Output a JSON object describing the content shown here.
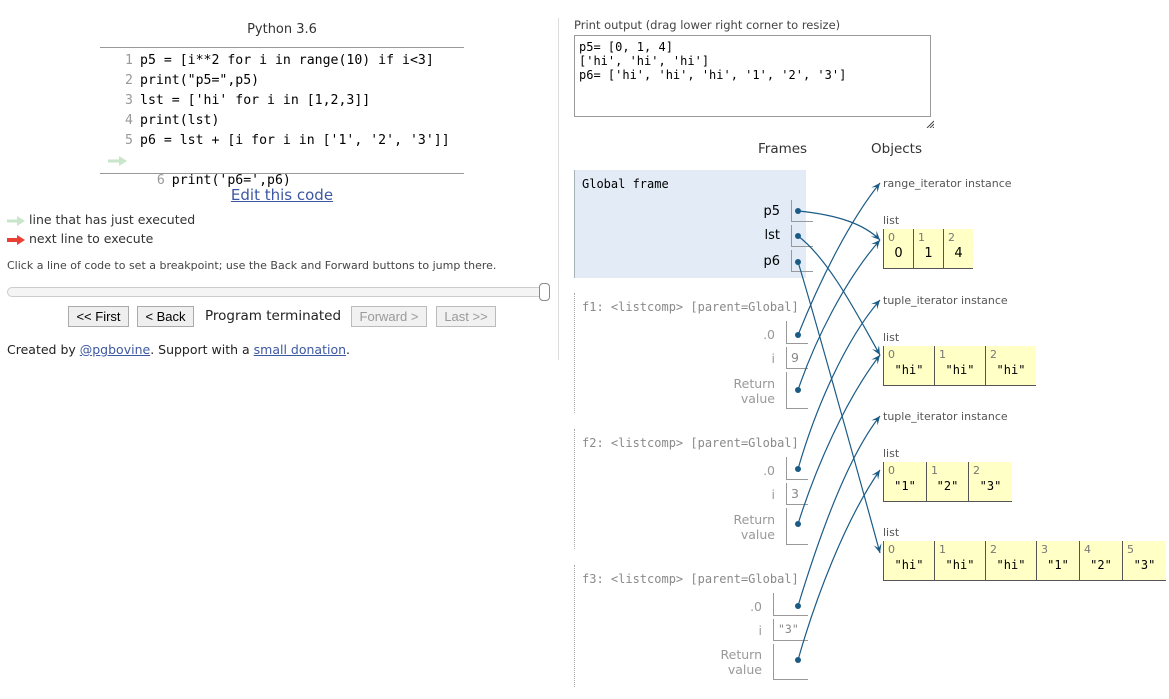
{
  "editor": {
    "language": "Python 3.6",
    "lines": [
      {
        "num": "1",
        "text": "p5 = [i**2 for i in range(10) if i<3]"
      },
      {
        "num": "2",
        "text": "print(\"p5=\",p5)"
      },
      {
        "num": "3",
        "text": "lst = ['hi' for i in [1,2,3]]"
      },
      {
        "num": "4",
        "text": "print(lst)"
      },
      {
        "num": "5",
        "text": "p6 = lst + [i for i in ['1', '2', '3']]"
      },
      {
        "num": "6",
        "text": "print('p6=',p6)"
      }
    ],
    "current_line": 6,
    "edit_link": "Edit this code"
  },
  "legend": {
    "executed": "line that has just executed",
    "next": "next line to execute",
    "executed_color": "#c9e6ca",
    "next_color": "#e93f34"
  },
  "hint": "Click a line of code to set a breakpoint; use the Back and Forward buttons to jump there.",
  "progress": {
    "fraction": 1.0
  },
  "nav": {
    "first": "<< First",
    "back": "< Back",
    "status": "Program terminated",
    "forward": "Forward >",
    "last": "Last >>"
  },
  "credit": {
    "prefix": "Created by ",
    "author": "@pgbovine",
    "middle": ". Support with a ",
    "donation": "small donation",
    "suffix": "."
  },
  "output": {
    "label": "Print output (drag lower right corner to resize)",
    "text": "p5= [0, 1, 4]\n['hi', 'hi', 'hi']\np6= ['hi', 'hi', 'hi', '1', '2', '3']"
  },
  "headers": {
    "frames": "Frames",
    "objects": "Objects"
  },
  "frames": {
    "global": {
      "title": "Global frame",
      "vars": [
        {
          "name": "p5"
        },
        {
          "name": "lst"
        },
        {
          "name": "p6"
        }
      ]
    },
    "f1": {
      "title": "f1: <listcomp> [parent=Global]",
      "dot0": ".0",
      "i_name": "i",
      "i_val": "9",
      "ret1": "Return",
      "ret2": "value"
    },
    "f2": {
      "title": "f2: <listcomp> [parent=Global]",
      "dot0": ".0",
      "i_name": "i",
      "i_val": "3",
      "ret1": "Return",
      "ret2": "value"
    },
    "f3": {
      "title": "f3: <listcomp> [parent=Global]",
      "dot0": ".0",
      "i_name": "i",
      "i_val": "\"3\"",
      "ret1": "Return",
      "ret2": "value"
    }
  },
  "objects": {
    "range_iter": "range_iterator instance",
    "tuple_iter1": "tuple_iterator instance",
    "tuple_iter2": "tuple_iterator instance",
    "list_label": "list",
    "list_p5": {
      "idx": [
        "0",
        "1",
        "2"
      ],
      "vals": [
        "0",
        "1",
        "4"
      ]
    },
    "list_lst": {
      "idx": [
        "0",
        "1",
        "2"
      ],
      "vals": [
        "\"hi\"",
        "\"hi\"",
        "\"hi\""
      ]
    },
    "list_123": {
      "idx": [
        "0",
        "1",
        "2"
      ],
      "vals": [
        "\"1\"",
        "\"2\"",
        "\"3\""
      ]
    },
    "list_p6": {
      "idx": [
        "0",
        "1",
        "2",
        "3",
        "4",
        "5"
      ],
      "vals": [
        "\"hi\"",
        "\"hi\"",
        "\"hi\"",
        "\"1\"",
        "\"2\"",
        "\"3\""
      ]
    }
  },
  "colors": {
    "arrow": "#1a5b86",
    "frame_bg": "#e2ebf6",
    "list_bg": "#ffffc6",
    "link": "#3d58a2"
  }
}
